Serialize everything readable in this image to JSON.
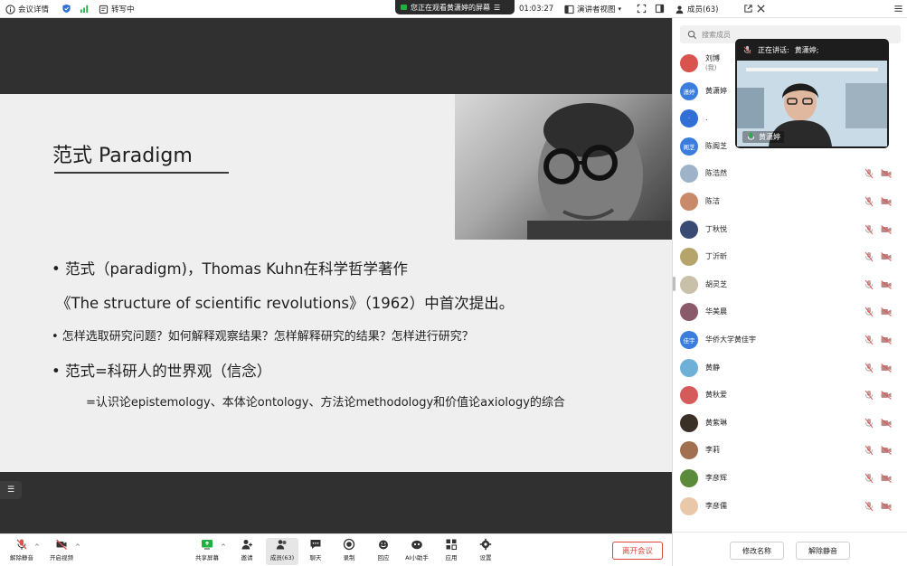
{
  "topbar": {
    "meeting_info": "会议详情",
    "transcribing": "转写中",
    "share_notice": "您正在观看黄潇婷的屏幕",
    "timer": "01:03:27",
    "view_mode": "演讲者视图",
    "members_tab": "成员(63)"
  },
  "slide": {
    "title": "范式 Paradigm",
    "line1": "• 范式（paradigm)，Thomas Kuhn在科学哲学著作",
    "line2": "《The structure of scientific revolutions》（1962）中首次提出。",
    "line3": "• 怎样选取研究问题？如何解释观察结果？怎样解释研究的结果？怎样进行研究？",
    "line4": "• 范式=科研人的世界观（信念）",
    "line5": "=认识论epistemology、本体论ontology、方法论methodology和价值论axiology的综合"
  },
  "toolbar": {
    "unmute": "解除静音",
    "start_video": "开启视频",
    "share_screen": "共享屏幕",
    "invite": "邀请",
    "members": "成员(63)",
    "chat": "聊天",
    "record": "录制",
    "reply": "回应",
    "ai_assistant": "AI小助手",
    "apps": "应用",
    "settings": "设置",
    "leave": "离开会议"
  },
  "panel": {
    "search_placeholder": "搜索成员",
    "members": [
      {
        "name": "刘博",
        "sub": "(我)",
        "avatar_text": "",
        "color": "#d9534f"
      },
      {
        "name": "黄潇婷",
        "sub": "",
        "avatar_text": "潇婷",
        "color": "#3b7ddd"
      },
      {
        "name": ".",
        "sub": "",
        "avatar_text": "·",
        "color": "#2f6fd6"
      },
      {
        "name": "陈阁芝",
        "sub": "",
        "avatar_text": "阁芝",
        "color": "#3b7ddd"
      },
      {
        "name": "陈浩然",
        "sub": "",
        "avatar_text": "",
        "color": "#9fb3c8"
      },
      {
        "name": "陈洁",
        "sub": "",
        "avatar_text": "",
        "color": "#c98a6a"
      },
      {
        "name": "丁秋悦",
        "sub": "",
        "avatar_text": "",
        "color": "#3a4a72"
      },
      {
        "name": "丁沂昕",
        "sub": "",
        "avatar_text": "",
        "color": "#b6a56a"
      },
      {
        "name": "胡灵芝",
        "sub": "",
        "avatar_text": "",
        "color": "#c8c0a8"
      },
      {
        "name": "华美晨",
        "sub": "",
        "avatar_text": "",
        "color": "#8a5a6a"
      },
      {
        "name": "华侨大学黄佳宇",
        "sub": "",
        "avatar_text": "佳宇",
        "color": "#3b7ddd"
      },
      {
        "name": "黄静",
        "sub": "",
        "avatar_text": "",
        "color": "#6fb0d8"
      },
      {
        "name": "黄秋爱",
        "sub": "",
        "avatar_text": "",
        "color": "#d55a5a"
      },
      {
        "name": "黄紫琳",
        "sub": "",
        "avatar_text": "",
        "color": "#3a3026"
      },
      {
        "name": "李莉",
        "sub": "",
        "avatar_text": "",
        "color": "#a07050"
      },
      {
        "name": "李彦辉",
        "sub": "",
        "avatar_text": "",
        "color": "#5b8a3a"
      },
      {
        "name": "李彦儒",
        "sub": "",
        "avatar_text": "",
        "color": "#e8c8a8"
      }
    ],
    "rename_button": "修改名称",
    "unmute_button": "解除静音"
  },
  "speaker": {
    "label": "正在讲话:",
    "name": "黄潇婷;",
    "video_name": "黄潇婷"
  },
  "colors": {
    "accent": "#3b7ddd",
    "leave": "#e0463c",
    "mic_muted": "#d9534f"
  }
}
